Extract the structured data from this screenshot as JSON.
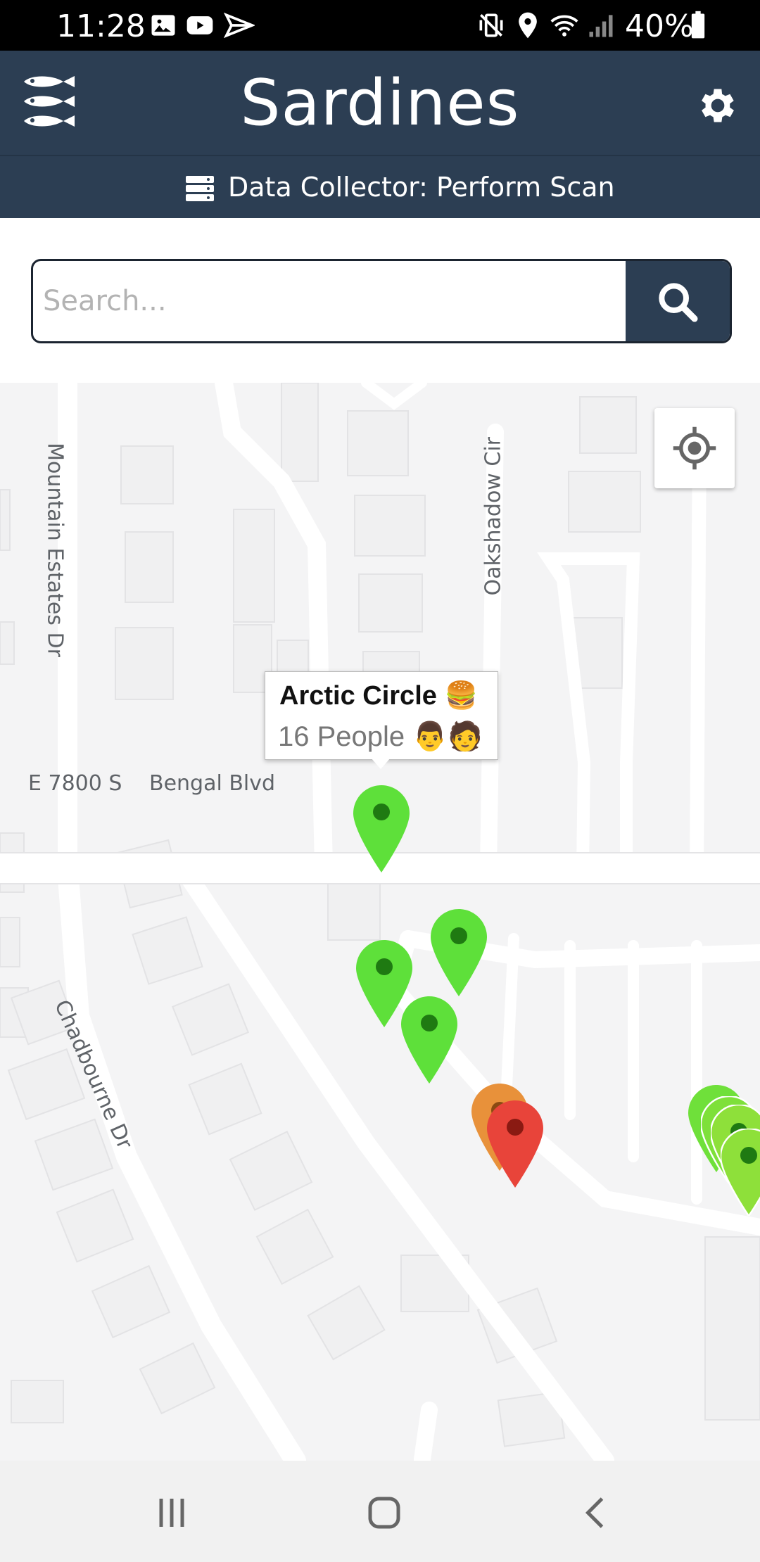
{
  "status_bar": {
    "time": "11:28",
    "battery": "40%",
    "left_icons": [
      "image-icon",
      "youtube-icon",
      "send-icon"
    ],
    "right_icons": [
      "vibrate-icon",
      "location-icon",
      "wifi-icon",
      "signal-icon",
      "battery-icon"
    ]
  },
  "app_bar": {
    "title": "Sardines",
    "logo_icon": "sardines-logo-icon",
    "settings_icon": "gear-icon"
  },
  "sub_bar": {
    "icon": "server-icon",
    "text": "Data Collector: Perform Scan"
  },
  "search": {
    "placeholder": "Search...",
    "value": "",
    "button_icon": "search-icon"
  },
  "map": {
    "road_labels": {
      "mountain_estates": "Mountain Estates Dr",
      "oakshadow": "Oakshadow Cir",
      "e7800": "E 7800 S",
      "bengal": "Bengal Blvd",
      "chadbourne": "Chadbourne Dr"
    },
    "locate_icon": "my-location-icon",
    "popup": {
      "name": "Arctic Circle",
      "name_emoji": "🍔",
      "count": "16 People",
      "count_emoji": "👨🧑"
    },
    "marker_colors": {
      "green": "#5ee03a",
      "orange": "#e8913a",
      "red": "#e8443a",
      "lime": "#8ee03a"
    }
  },
  "nav_bar": {
    "icons": [
      "recent-apps-icon",
      "home-icon",
      "back-icon"
    ]
  },
  "colors": {
    "brand": "#2c3e53",
    "status_bar": "#000000"
  }
}
